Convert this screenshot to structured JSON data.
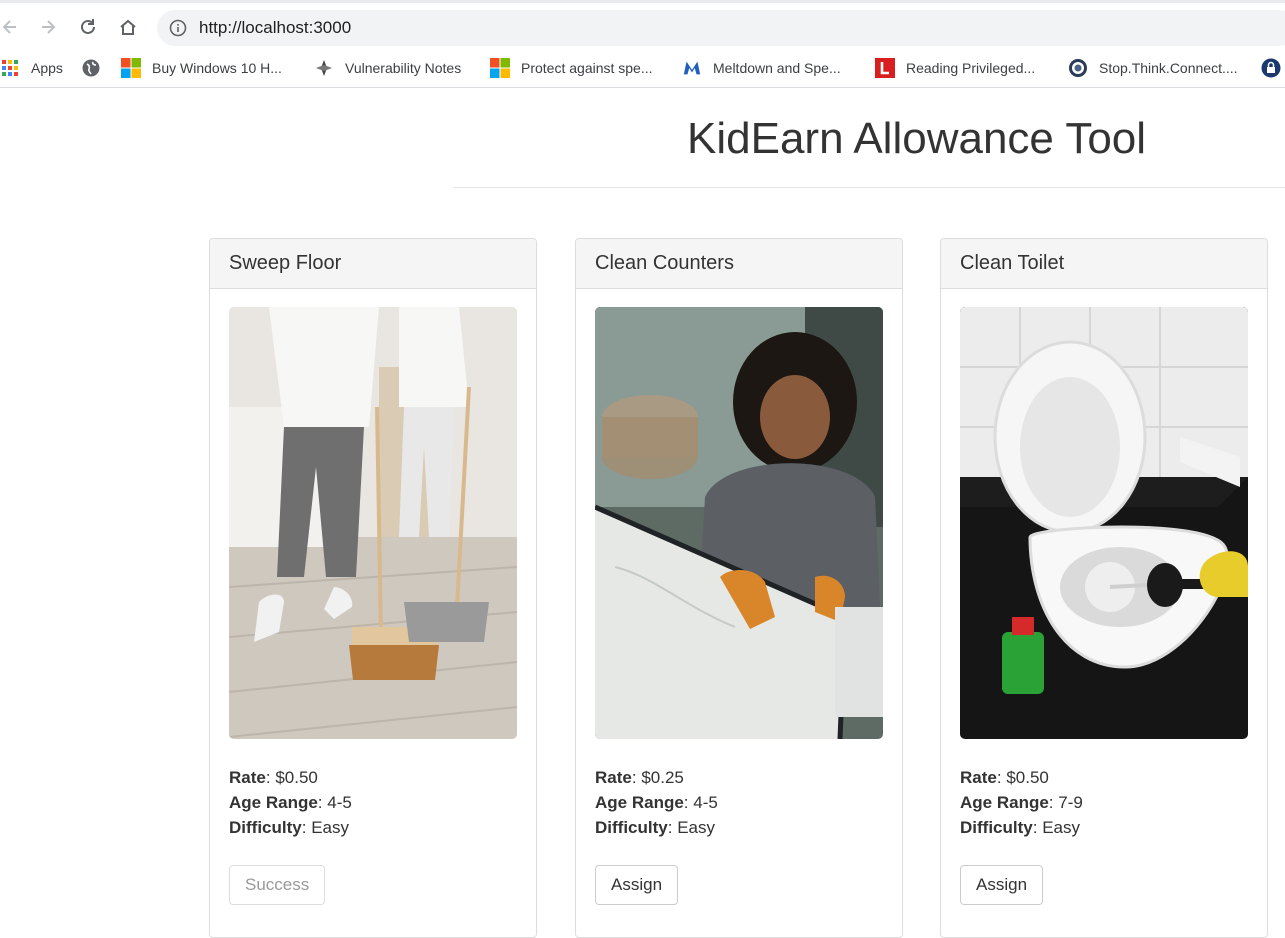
{
  "browser": {
    "url": "http://localhost:3000",
    "bookmarks": [
      {
        "label": "Apps",
        "icon": "apps-grid-icon"
      },
      {
        "label": "",
        "icon": "globe-icon"
      },
      {
        "label": "Buy Windows 10 H...",
        "icon": "windows-logo-icon"
      },
      {
        "label": "Vulnerability Notes",
        "icon": "cert-icon"
      },
      {
        "label": "Protect against spe...",
        "icon": "windows-logo-icon"
      },
      {
        "label": "Meltdown and Spe...",
        "icon": "malwarebytes-icon"
      },
      {
        "label": "Reading Privileged...",
        "icon": "l-logo-icon"
      },
      {
        "label": "Stop.Think.Connect....",
        "icon": "dhs-seal-icon"
      },
      {
        "label": "",
        "icon": "lock-icon"
      }
    ]
  },
  "page": {
    "title": "KidEarn Allowance Tool"
  },
  "chores": [
    {
      "name": "Sweep Floor",
      "rate_label": "Rate",
      "rate": "$0.50",
      "age_label": "Age Range",
      "age": "4-5",
      "difficulty_label": "Difficulty",
      "difficulty": "Easy",
      "button": "Success",
      "button_state": "disabled",
      "image": "sweeping-photo"
    },
    {
      "name": "Clean Counters",
      "rate_label": "Rate",
      "rate": "$0.25",
      "age_label": "Age Range",
      "age": "4-5",
      "difficulty_label": "Difficulty",
      "difficulty": "Easy",
      "button": "Assign",
      "button_state": "enabled",
      "image": "counter-cleaning-photo"
    },
    {
      "name": "Clean Toilet",
      "rate_label": "Rate",
      "rate": "$0.50",
      "age_label": "Age Range",
      "age": "7-9",
      "difficulty_label": "Difficulty",
      "difficulty": "Easy",
      "button": "Assign",
      "button_state": "enabled",
      "image": "toilet-cleaning-photo"
    }
  ]
}
